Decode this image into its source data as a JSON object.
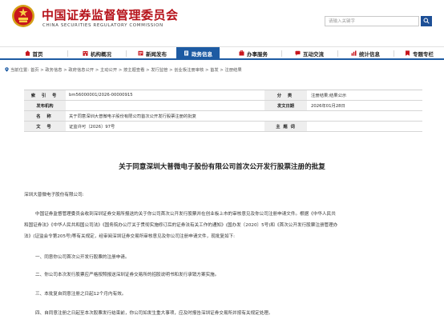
{
  "header": {
    "title_cn": "中国证券监督管理委员会",
    "title_en": "CHINA SECURITIES REGULATORY COMMISSION",
    "search_placeholder": "请输入关键字",
    "brand_red": "#b6121a",
    "nav_blue": "#1d5ba3",
    "emblem_icon": "national-emblem-icon",
    "search_icon": "search-icon"
  },
  "nav": {
    "items": [
      {
        "label": "首页",
        "icon": "home-icon"
      },
      {
        "label": "机构概况",
        "icon": "building-icon"
      },
      {
        "label": "新闻发布",
        "icon": "news-icon"
      },
      {
        "label": "政务信息",
        "icon": "document-icon",
        "active": true
      },
      {
        "label": "办事服务",
        "icon": "service-icon"
      },
      {
        "label": "互动交流",
        "icon": "chat-icon"
      },
      {
        "label": "统计信息",
        "icon": "chart-icon"
      },
      {
        "label": "专题专栏",
        "icon": "bookmark-icon"
      }
    ]
  },
  "breadcrumb": {
    "prefix": "当前位置:",
    "path": "首页 > 政务信息 > 政府信息公开 > 主动公开 > 按主题查看 > 发行监管 > 创业板注册审核 > 首发 > 注册结果"
  },
  "info": {
    "index_label": "索 引 号",
    "index_value": "bm56000001/2026-00000915",
    "category_label": "分 类",
    "category_value": "注册结果;结果公示",
    "issuer_label": "发布机构",
    "issuer_value": "",
    "date_label": "发文日期",
    "date_value": "2026年01月28日",
    "name_label": "名 称",
    "name_value": "关于同意深圳大普微电子股份有限公司首次公开发行股票注册的批复",
    "doc_label": "文 号",
    "doc_value": "证监许可〔2026〕97号",
    "topic_label": "主 题 词",
    "topic_value": ""
  },
  "article": {
    "title": "关于同意深圳大普微电子股份有限公司首次公开发行股票注册的批复",
    "salutation": "深圳大普微电子股份有限公司:",
    "p1_l1": "中国证券监督管理委员会收到深圳证券交易所报送的关于你公司首次公开发行股票并在创业板上市的审核意见及你公司注册申请文件。根据《中华人民共",
    "p1_l2": "和国证券法》《中华人民共和国公司法》《国务院办公厅关于贯彻实施修订后的证券法有关工作的通知》(国办发〔2020〕5号)和《首次公开发行股票注册管理办",
    "p1_l3": "法》(证监会令第205号)等有关规定，经审阅深圳证券交易所审核意见及你公司注册申请文件，现批复如下:",
    "item1": "一、同意你公司首次公开发行股票的注册申请。",
    "item2": "二、你公司本次发行股票应严格按照报送深圳证券交易所的招股说明书和发行承销方案实施。",
    "item3": "三、本批复自同意注册之日起12个月内有效。",
    "item4": "四、自同意注册之日起至本次股票发行结束前，你公司如发生重大事项，应及时报告深圳证券交易所并按有关规定处理。"
  }
}
